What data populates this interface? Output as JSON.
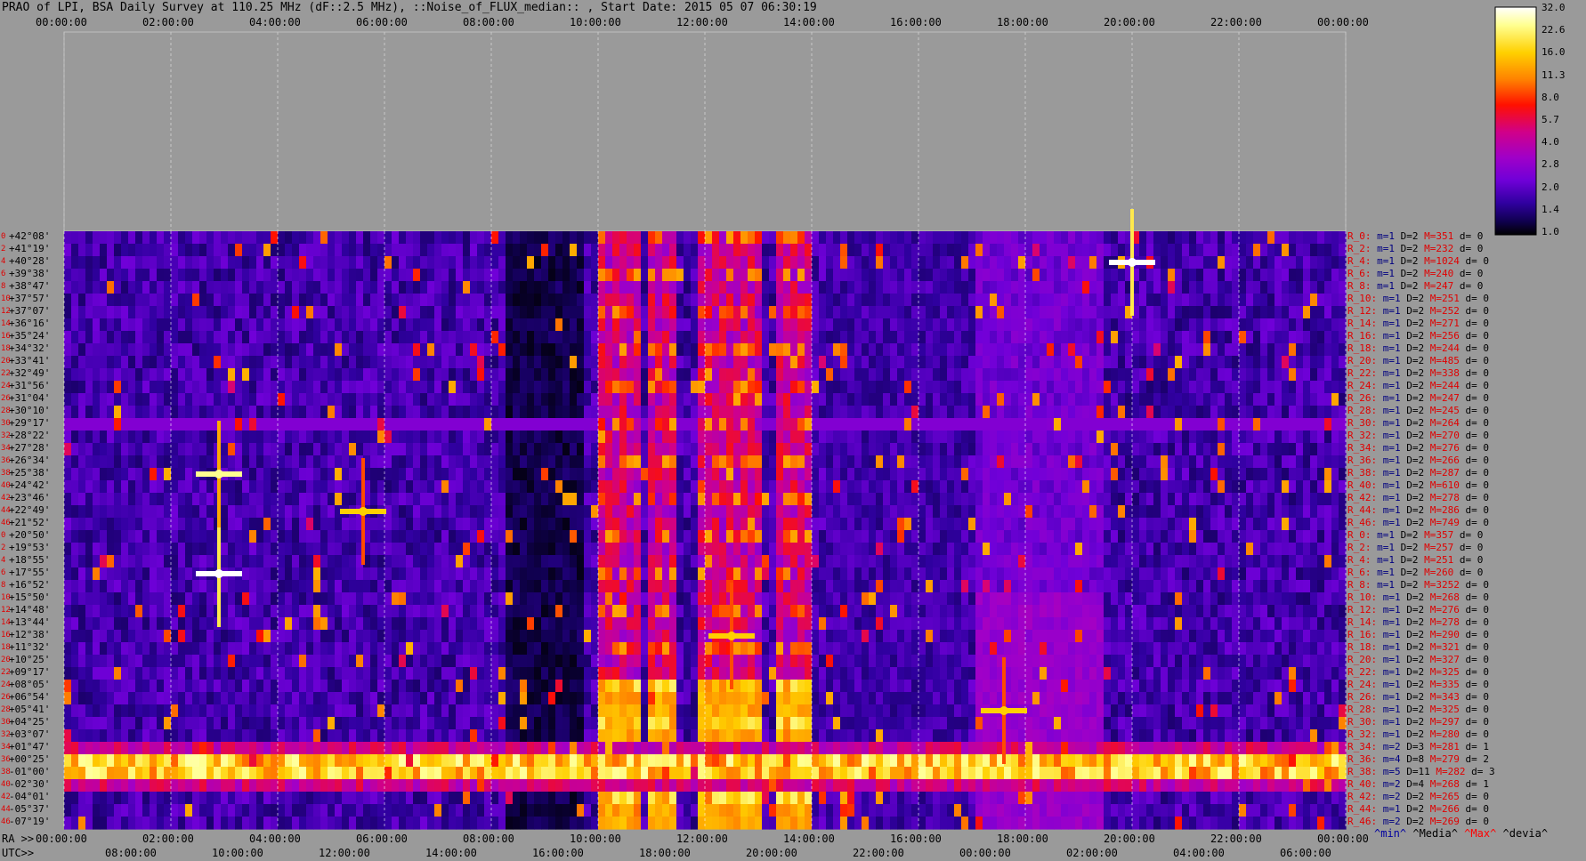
{
  "title": "PRAO of LPI, BSA Daily Survey at 110.25 MHz (dF::2.5 MHz), ::Noise_of_FLUX_median:: , Start Date: 2015 05 07 06:30:19",
  "top_ticks": [
    "00:00:00",
    "02:00:00",
    "04:00:00",
    "06:00:00",
    "08:00:00",
    "10:00:00",
    "12:00:00",
    "14:00:00",
    "16:00:00",
    "18:00:00",
    "20:00:00",
    "22:00:00",
    "00:00:00"
  ],
  "bottom_ra_label": "RA >>",
  "bottom_ra_ticks": [
    "00:00:00",
    "02:00:00",
    "04:00:00",
    "06:00:00",
    "08:00:00",
    "10:00:00",
    "12:00:00",
    "14:00:00",
    "16:00:00",
    "18:00:00",
    "20:00:00",
    "22:00:00",
    "00:00:00"
  ],
  "bottom_utc_label": "UTC>>",
  "bottom_utc_ticks": [
    "08:00:00",
    "10:00:00",
    "12:00:00",
    "14:00:00",
    "16:00:00",
    "18:00:00",
    "20:00:00",
    "22:00:00",
    "00:00:00",
    "02:00:00",
    "04:00:00",
    "06:00:00"
  ],
  "colorbar": {
    "labels": [
      "32.0",
      "22.6",
      "16.0",
      "11.3",
      "8.0",
      "5.7",
      "4.0",
      "2.8",
      "2.0",
      "1.4",
      "1.0"
    ],
    "colors": [
      "#ffffff",
      "#ffff80",
      "#ffd000",
      "#ff8000",
      "#ff0000",
      "#d00080",
      "#a000c0",
      "#7000d0",
      "#3000a0",
      "#100050",
      "#000000"
    ]
  },
  "legend": {
    "min": "^min^",
    "median": "^Media^",
    "max": "^Max^",
    "dev": "^devia^"
  },
  "chart_data": {
    "type": "heatmap",
    "x_label": "RA / UTC",
    "declinations": [
      "+42°08'",
      "+41°19'",
      "+40°28'",
      "+39°38'",
      "+38°47'",
      "+37°57'",
      "+37°07'",
      "+36°16'",
      "+35°24'",
      "+34°32'",
      "+33°41'",
      "+32°49'",
      "+31°56'",
      "+31°04'",
      "+30°10'",
      "+29°17'",
      "+28°22'",
      "+27°28'",
      "+26°34'",
      "+25°38'",
      "+24°42'",
      "+23°46'",
      "+22°49'",
      "+21°52'",
      "+20°50'",
      "+19°53'",
      "+18°55'",
      "+17°55'",
      "+16°52'",
      "+15°50'",
      "+14°48'",
      "+13°44'",
      "+12°38'",
      "+11°32'",
      "+10°25'",
      "+09°17'",
      "+08°05'",
      "+06°54'",
      "+05°41'",
      "+04°25'",
      "+03°07'",
      "+01°47'",
      "+00°25'",
      "-01°00'",
      "-02°30'",
      "-04°01'",
      "-05°37'",
      "-07°19'"
    ],
    "row_stats": [
      {
        "r": "R_0:",
        "m": "m=1",
        "D": "D=2",
        "M": "M=351",
        "d": "d= 0"
      },
      {
        "r": "R_2:",
        "m": "m=1",
        "D": "D=2",
        "M": "M=232",
        "d": "d= 0"
      },
      {
        "r": "R_4:",
        "m": "m=1",
        "D": "D=2",
        "M": "M=1024",
        "d": "d= 0"
      },
      {
        "r": "R_6:",
        "m": "m=1",
        "D": "D=2",
        "M": "M=240",
        "d": "d= 0"
      },
      {
        "r": "R_8:",
        "m": "m=1",
        "D": "D=2",
        "M": "M=247",
        "d": "d= 0"
      },
      {
        "r": "R_10:",
        "m": "m=1",
        "D": "D=2",
        "M": "M=251",
        "d": "d= 0"
      },
      {
        "r": "R_12:",
        "m": "m=1",
        "D": "D=2",
        "M": "M=252",
        "d": "d= 0"
      },
      {
        "r": "R_14:",
        "m": "m=1",
        "D": "D=2",
        "M": "M=271",
        "d": "d= 0"
      },
      {
        "r": "R_16:",
        "m": "m=1",
        "D": "D=2",
        "M": "M=256",
        "d": "d= 0"
      },
      {
        "r": "R_18:",
        "m": "m=1",
        "D": "D=2",
        "M": "M=244",
        "d": "d= 0"
      },
      {
        "r": "R_20:",
        "m": "m=1",
        "D": "D=2",
        "M": "M=485",
        "d": "d= 0"
      },
      {
        "r": "R_22:",
        "m": "m=1",
        "D": "D=2",
        "M": "M=338",
        "d": "d= 0"
      },
      {
        "r": "R_24:",
        "m": "m=1",
        "D": "D=2",
        "M": "M=244",
        "d": "d= 0"
      },
      {
        "r": "R_26:",
        "m": "m=1",
        "D": "D=2",
        "M": "M=247",
        "d": "d= 0"
      },
      {
        "r": "R_28:",
        "m": "m=1",
        "D": "D=2",
        "M": "M=245",
        "d": "d= 0"
      },
      {
        "r": "R_30:",
        "m": "m=1",
        "D": "D=2",
        "M": "M=264",
        "d": "d= 0"
      },
      {
        "r": "R_32:",
        "m": "m=1",
        "D": "D=2",
        "M": "M=270",
        "d": "d= 0"
      },
      {
        "r": "R_34:",
        "m": "m=1",
        "D": "D=2",
        "M": "M=276",
        "d": "d= 0"
      },
      {
        "r": "R_36:",
        "m": "m=1",
        "D": "D=2",
        "M": "M=266",
        "d": "d= 0"
      },
      {
        "r": "R_38:",
        "m": "m=1",
        "D": "D=2",
        "M": "M=287",
        "d": "d= 0"
      },
      {
        "r": "R_40:",
        "m": "m=1",
        "D": "D=2",
        "M": "M=610",
        "d": "d= 0"
      },
      {
        "r": "R_42:",
        "m": "m=1",
        "D": "D=2",
        "M": "M=278",
        "d": "d= 0"
      },
      {
        "r": "R_44:",
        "m": "m=1",
        "D": "D=2",
        "M": "M=286",
        "d": "d= 0"
      },
      {
        "r": "R_46:",
        "m": "m=1",
        "D": "D=2",
        "M": "M=749",
        "d": "d= 0"
      },
      {
        "r": "R_0:",
        "m": "m=1",
        "D": "D=2",
        "M": "M=357",
        "d": "d= 0"
      },
      {
        "r": "R_2:",
        "m": "m=1",
        "D": "D=2",
        "M": "M=257",
        "d": "d= 0"
      },
      {
        "r": "R_4:",
        "m": "m=1",
        "D": "D=2",
        "M": "M=251",
        "d": "d= 0"
      },
      {
        "r": "R_6:",
        "m": "m=1",
        "D": "D=2",
        "M": "M=260",
        "d": "d= 0"
      },
      {
        "r": "R_8:",
        "m": "m=1",
        "D": "D=2",
        "M": "M=3252",
        "d": "d= 0"
      },
      {
        "r": "R_10:",
        "m": "m=1",
        "D": "D=2",
        "M": "M=268",
        "d": "d= 0"
      },
      {
        "r": "R_12:",
        "m": "m=1",
        "D": "D=2",
        "M": "M=276",
        "d": "d= 0"
      },
      {
        "r": "R_14:",
        "m": "m=1",
        "D": "D=2",
        "M": "M=278",
        "d": "d= 0"
      },
      {
        "r": "R_16:",
        "m": "m=1",
        "D": "D=2",
        "M": "M=290",
        "d": "d= 0"
      },
      {
        "r": "R_18:",
        "m": "m=1",
        "D": "D=2",
        "M": "M=321",
        "d": "d= 0"
      },
      {
        "r": "R_20:",
        "m": "m=1",
        "D": "D=2",
        "M": "M=327",
        "d": "d= 0"
      },
      {
        "r": "R_22:",
        "m": "m=1",
        "D": "D=2",
        "M": "M=325",
        "d": "d= 0"
      },
      {
        "r": "R_24:",
        "m": "m=1",
        "D": "D=2",
        "M": "M=335",
        "d": "d= 0"
      },
      {
        "r": "R_26:",
        "m": "m=1",
        "D": "D=2",
        "M": "M=343",
        "d": "d= 0"
      },
      {
        "r": "R_28:",
        "m": "m=1",
        "D": "D=2",
        "M": "M=325",
        "d": "d= 0"
      },
      {
        "r": "R_30:",
        "m": "m=1",
        "D": "D=2",
        "M": "M=297",
        "d": "d= 0"
      },
      {
        "r": "R_32:",
        "m": "m=1",
        "D": "D=2",
        "M": "M=280",
        "d": "d= 0"
      },
      {
        "r": "R_34:",
        "m": "m=2",
        "D": "D=3",
        "M": "M=281",
        "d": "d= 1"
      },
      {
        "r": "R_36:",
        "m": "m=4",
        "D": "D=8",
        "M": "M=279",
        "d": "d= 2"
      },
      {
        "r": "R_38:",
        "m": "m=5",
        "D": "D=11",
        "M": "M=282",
        "d": "d= 3"
      },
      {
        "r": "R_40:",
        "m": "m=2",
        "D": "D=4",
        "M": "M=268",
        "d": "d= 1"
      },
      {
        "r": "R_42:",
        "m": "m=2",
        "D": "D=2",
        "M": "M=265",
        "d": "d= 0"
      },
      {
        "r": "R_44:",
        "m": "m=1",
        "D": "D=2",
        "M": "M=266",
        "d": "d= 0"
      },
      {
        "r": "R_46:",
        "m": "m=2",
        "D": "D=2",
        "M": "M=269",
        "d": "d= 0"
      }
    ],
    "row_indices": [
      "0",
      "2",
      "4",
      "6",
      "8",
      "10",
      "12",
      "14",
      "16",
      "18",
      "20",
      "22",
      "24",
      "26",
      "28",
      "30",
      "32",
      "34",
      "36",
      "38",
      "40",
      "42",
      "44",
      "46",
      "0",
      "2",
      "4",
      "6",
      "8",
      "10",
      "12",
      "14",
      "16",
      "18",
      "20",
      "22",
      "24",
      "26",
      "28",
      "30",
      "32",
      "34",
      "36",
      "38",
      "40",
      "42",
      "44",
      "46"
    ],
    "x_hours_range": [
      0,
      24
    ],
    "bright_bands_hours": [
      [
        10.0,
        10.8
      ],
      [
        11.0,
        11.5
      ],
      [
        11.8,
        13.1
      ],
      [
        13.3,
        14.0
      ]
    ],
    "equator_band_rows": [
      41,
      42,
      43,
      44
    ],
    "point_sources": [
      {
        "ra_h": 2.9,
        "row": 27,
        "level": 32
      },
      {
        "ra_h": 2.9,
        "row": 19,
        "level": 22.6
      },
      {
        "ra_h": 20.0,
        "row": 2,
        "level": 32
      },
      {
        "ra_h": 5.6,
        "row": 22,
        "level": 16
      },
      {
        "ra_h": 12.5,
        "row": 32,
        "level": 16
      },
      {
        "ra_h": 17.6,
        "row": 38,
        "level": 16
      }
    ]
  }
}
